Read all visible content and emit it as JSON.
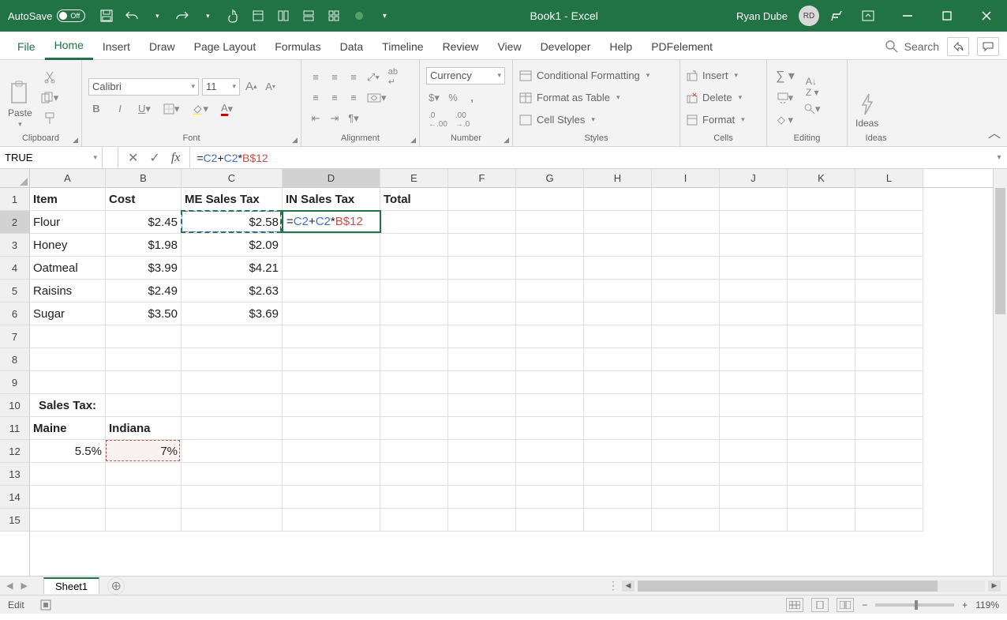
{
  "titlebar": {
    "autosave_label": "AutoSave",
    "autosave_state": "Off",
    "title": "Book1 - Excel",
    "user_name": "Ryan Dube",
    "user_initials": "RD"
  },
  "tabs": {
    "items": [
      "File",
      "Home",
      "Insert",
      "Draw",
      "Page Layout",
      "Formulas",
      "Data",
      "Timeline",
      "Review",
      "View",
      "Developer",
      "Help",
      "PDFelement"
    ],
    "active": "Home",
    "search_label": "Search"
  },
  "ribbon": {
    "clipboard": {
      "label": "Clipboard",
      "paste": "Paste"
    },
    "font": {
      "label": "Font",
      "name": "Calibri",
      "size": "11"
    },
    "alignment": {
      "label": "Alignment"
    },
    "number": {
      "label": "Number",
      "format": "Currency"
    },
    "styles": {
      "label": "Styles",
      "conditional": "Conditional Formatting",
      "table": "Format as Table",
      "cellstyles": "Cell Styles"
    },
    "cells": {
      "label": "Cells",
      "insert": "Insert",
      "delete": "Delete",
      "format": "Format"
    },
    "editing": {
      "label": "Editing"
    },
    "ideas": {
      "label": "Ideas",
      "btn": "Ideas"
    }
  },
  "namebox": "TRUE",
  "formula": {
    "raw": "=C2+C2*B$12",
    "parts": [
      {
        "text": "=",
        "color": "#222"
      },
      {
        "text": "C2",
        "color": "#3a72c9"
      },
      {
        "text": "+",
        "color": "#222"
      },
      {
        "text": "C2",
        "color": "#3a72c9"
      },
      {
        "text": "*",
        "color": "#222"
      },
      {
        "text": "B$12",
        "color": "#c0504d"
      }
    ]
  },
  "grid": {
    "columns": [
      "A",
      "B",
      "C",
      "D",
      "E",
      "F",
      "G",
      "H",
      "I",
      "J",
      "K",
      "L"
    ],
    "row_count": 15,
    "active_col": "D",
    "active_row": 2,
    "headers": {
      "A1": "Item",
      "B1": "Cost",
      "C1": "ME Sales Tax",
      "D1": "IN Sales Tax",
      "E1": "Total"
    },
    "data": {
      "A2": "Flour",
      "B2": "$2.45",
      "C2": "$2.58",
      "A3": "Honey",
      "B3": "$1.98",
      "C3": "$2.09",
      "A4": "Oatmeal",
      "B4": "$3.99",
      "C4": "$4.21",
      "A5": "Raisins",
      "B5": "$2.49",
      "C5": "$2.63",
      "A6": "Sugar",
      "B6": "$3.50",
      "C6": "$3.69",
      "A10": "Sales Tax:",
      "A11": "Maine",
      "B11": "Indiana",
      "A12": "5.5%",
      "B12": "7%"
    }
  },
  "sheet": {
    "name": "Sheet1"
  },
  "status": {
    "mode": "Edit",
    "zoom": "119%"
  }
}
